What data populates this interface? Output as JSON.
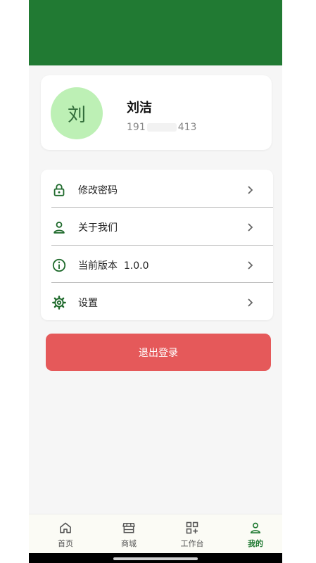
{
  "profile": {
    "avatar_char": "刘",
    "name": "刘洁",
    "phone_prefix": "191",
    "phone_suffix": "413"
  },
  "menu": {
    "items": [
      {
        "label": "修改密码",
        "icon": "lock-icon"
      },
      {
        "label": "关于我们",
        "icon": "user-icon"
      },
      {
        "label": "当前版本  1.0.0",
        "icon": "info-icon"
      },
      {
        "label": "设置",
        "icon": "gear-icon"
      }
    ]
  },
  "logout": {
    "label": "退出登录"
  },
  "tabbar": {
    "items": [
      {
        "label": "首页",
        "icon": "home-icon"
      },
      {
        "label": "商城",
        "icon": "store-icon"
      },
      {
        "label": "工作台",
        "icon": "workbench-icon"
      },
      {
        "label": "我的",
        "icon": "profile-icon"
      }
    ],
    "active": "我的"
  },
  "colors": {
    "brand": "#217a33",
    "avatar_bg": "#bdf0b5",
    "logout_bg": "#e5595a",
    "icon": "#1f6a2c"
  }
}
